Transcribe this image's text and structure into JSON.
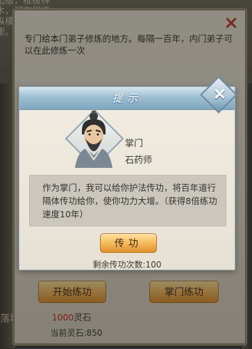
{
  "background": {
    "top_left_text": "出版，稚极林木，河有阁道纵横，市肆通衢。落视",
    "bottom_left_text": "落坊"
  },
  "panel": {
    "description": "专门给本门弟子修炼的地方。每隔一百年，内门弟子可以在此修炼一次",
    "close_icon": "×",
    "start_button": "开始练功",
    "master_button": "掌门练功",
    "cost_amount": "1000",
    "cost_unit": "灵石",
    "current_stone": "当前灵石:850"
  },
  "dialog": {
    "title": "提示",
    "close_icon": "×",
    "npc_title": "掌门",
    "npc_name": "石药师",
    "message": "作为掌门，我可以给你护法传功，将百年道行隔体传功给你，使你功力大增。（获得8倍练功速度10年）",
    "transfer_button": "传功",
    "remaining": "剩余传功次数:100"
  },
  "colors": {
    "accent_gold": "#f4b65a",
    "cost_red": "#c9281c",
    "header_blue": "#9fbfd2",
    "close_red": "#c33a2a"
  }
}
